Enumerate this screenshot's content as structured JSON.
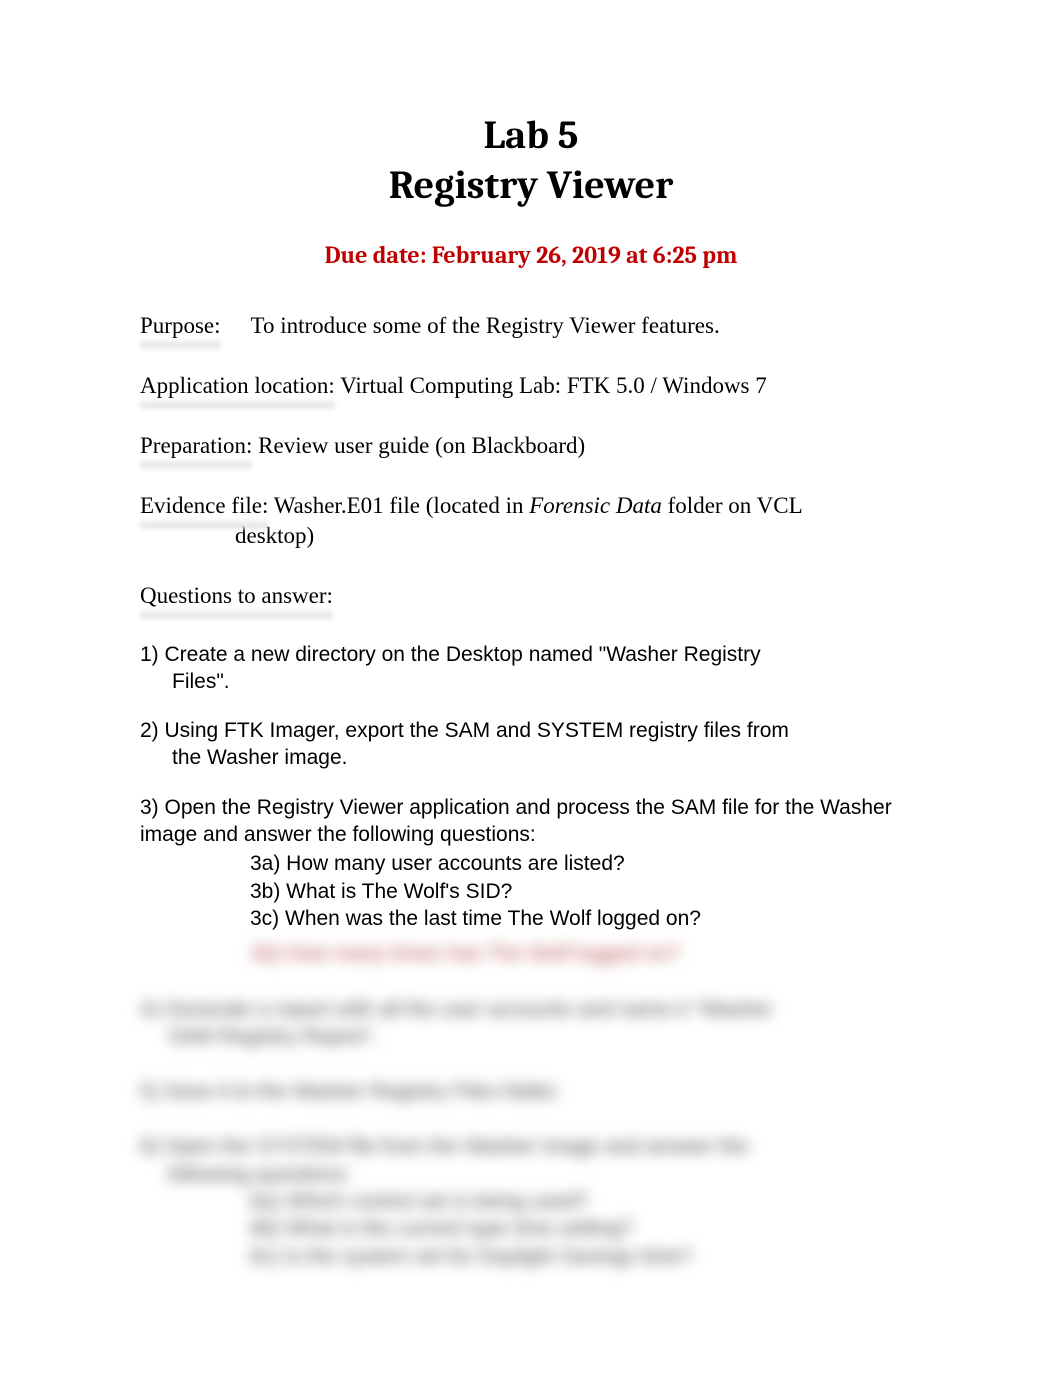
{
  "title": {
    "line1": "Lab 5",
    "line2": "Registry Viewer"
  },
  "due_date": "Due date: February 26, 2019 at 6:25 pm",
  "purpose": {
    "label": "Purpose:",
    "text": "To introduce some of the Registry Viewer features."
  },
  "application": {
    "label": "Application location:",
    "text": "  Virtual Computing Lab:  FTK 5.0 / Windows 7"
  },
  "preparation": {
    "label": "Preparation:",
    "text": " Review user guide (on Blackboard)"
  },
  "evidence": {
    "label": "Evidence file:",
    "text_before": " Washer.E01 file (located in  ",
    "italic": "Forensic Data",
    "text_after": " folder on VCL",
    "line2": "desktop)"
  },
  "questions_label": "Questions to answer:",
  "questions": {
    "q1": "1) Create a new directory on the Desktop named \"Washer Registry",
    "q1b": "Files\".",
    "q2": "2) Using FTK Imager, export the SAM and SYSTEM registry files from",
    "q2b": "the Washer image.",
    "q3": "3) Open the Registry Viewer application and process the SAM file for the Washer image and answer the following questions:",
    "q3a": "3a) How many user accounts are listed?",
    "q3b": "3b) What is The Wolf's SID?",
    "q3c": "3c) When was the last time The Wolf logged on?"
  },
  "blurred": {
    "q3d": "3d) How many times has The Wolf logged on?",
    "q4a": "4) Generate a report with all the user accounts and name it \"Washer",
    "q4b": "SAM Registry Report\".",
    "q5": "5) Save it to the Washer Registry Files folder.",
    "q6a": "6) Open the SYSTEM file from the Washer image and answer the",
    "q6b": "following questions:",
    "q6c": "6a) Which control set is being used?",
    "q6d": "6b) What is the current type time setting?",
    "q6e": "6c) Is the system set for Daylight Savings time?"
  }
}
